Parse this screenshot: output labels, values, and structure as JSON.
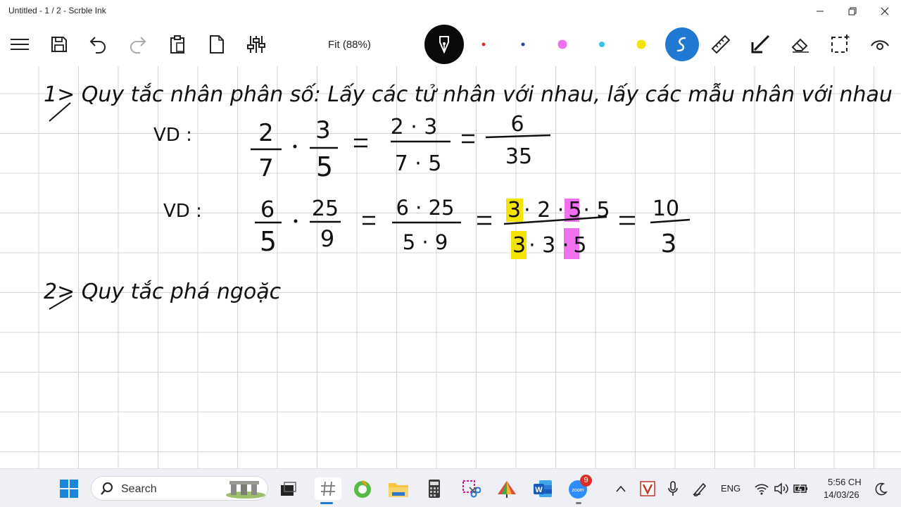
{
  "window": {
    "title": "Untitled - 1 / 2 - Scrble Ink"
  },
  "toolbar": {
    "zoom": "Fit (88%)",
    "pen_colors": [
      "#d32f2f",
      "#1e3fb0",
      "#f070f0",
      "#35c5e8",
      "#f5e400"
    ],
    "accent": "#1f78d1"
  },
  "note": {
    "line1": "1> Quy tắc nhân phân số: Lấy các tử nhân với nhau, lấy các mẫu nhân với nhau",
    "ex_label_1": "VD :",
    "ex_label_2": "VD :",
    "eq1": {
      "a_num": "2",
      "a_den": "7",
      "b_num": "3",
      "b_den": "5",
      "c_num": "2 · 3",
      "c_den": "7 · 5",
      "d_num": "6",
      "d_den": "35"
    },
    "eq2": {
      "a_num": "6",
      "a_den": "5",
      "b_num": "25",
      "b_den": "9",
      "c_num": "6 · 25",
      "c_den": "5 · 9",
      "d_num": [
        "3",
        "· 2 ·",
        "5",
        "· 5"
      ],
      "d_den": [
        "3",
        "· 3 ·",
        "5"
      ],
      "e_num": "10",
      "e_den": "3"
    },
    "line2": "2> Quy tắc phá ngoặc",
    "highlight_colors": {
      "yellow": "#f5e400",
      "pink": "#f070f0"
    }
  },
  "taskbar": {
    "search_placeholder": "Search",
    "language": "ENG",
    "time": "5:56 CH",
    "date": "14/03/26",
    "zoom_badge": "9"
  }
}
